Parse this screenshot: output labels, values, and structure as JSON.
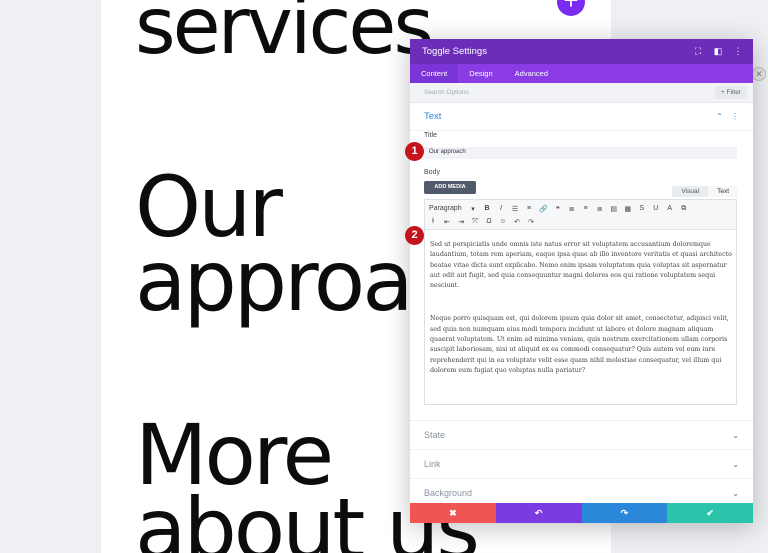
{
  "canvas": {
    "heading1": "services",
    "heading2_line1": "Our",
    "heading2_line2": "approa",
    "heading3_line1": "More",
    "heading3_line2": "about us",
    "add_button_icon": "plus-icon"
  },
  "modal": {
    "title": "Toggle Settings",
    "header_icons": [
      "expand-icon",
      "columns-icon",
      "more-vertical-icon"
    ],
    "tabs": [
      {
        "label": "Content",
        "active": true
      },
      {
        "label": "Design",
        "active": false
      },
      {
        "label": "Advanced",
        "active": false
      }
    ],
    "search_placeholder": "Search Options",
    "filter_label": "+ Filter",
    "text_section": {
      "title": "Text",
      "title_field_label": "Title",
      "title_value": "Our approach",
      "body_field_label": "Body",
      "add_media_label": "ADD MEDIA",
      "editor_tabs": [
        "Visual",
        "Text"
      ],
      "paragraph_select": "Paragraph",
      "body_paragraphs": [
        "Sed ut perspiciatis unde omnis iste natus error sit voluptatem accusantium doloremque laudantium, totam rem aperiam, eaque ipsa quae ab illo inventore veritatis et quasi architecto beatae vitae dicta sunt explicabo. Nemo enim ipsam voluptatem quia voluptas sit aspernatur aut odit aut fugit, sed quia consequuntur magni dolores eos qui ratione voluptatem sequi nesciunt.",
        "Neque porro quisquam est, qui dolorem ipsum quia dolor sit amet, consectetur, adipisci velit, sed quia non numquam eius modi tempora incidunt ut labore et dolore magnam aliquam quaerat voluptatem. Ut enim ad minima veniam, quis nostrum exercitationem ullam corporis suscipit laboriosam, nisi ut aliquid ex ea commodi consequatur? Quis autem vel eum iure reprehenderit qui in ea voluptate velit esse quam nihil molestiae consequatur, vel illum qui dolorem eum fugiat quo voluptas nulla pariatur?"
      ]
    },
    "collapsed_sections": [
      "State",
      "Link",
      "Background"
    ],
    "footer": {
      "cancel": "✖",
      "undo": "↶",
      "redo": "↷",
      "save": "✔"
    }
  },
  "markers": [
    "1",
    "2"
  ],
  "colors": {
    "header": "#6c2eb9",
    "tabs": "#8a3be3",
    "accent": "#2b87da",
    "cancel": "#ef5555",
    "undo": "#7c3ae1",
    "redo": "#2b87da",
    "save": "#29c4a9",
    "marker": "#c6141c"
  }
}
